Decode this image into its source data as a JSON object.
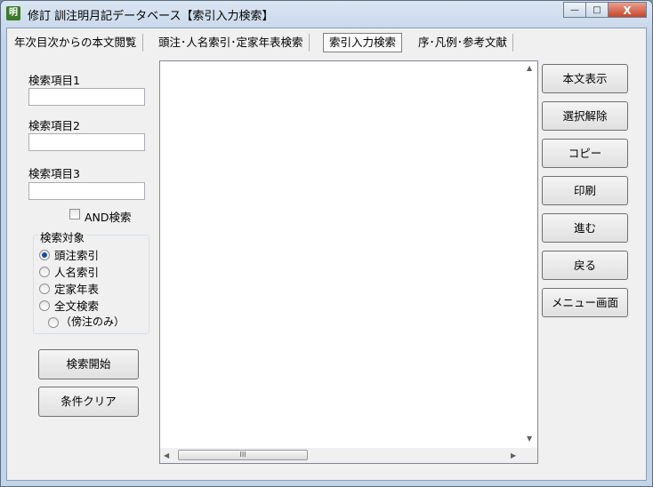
{
  "window": {
    "title": "修訂 訓注明月記データベース【索引入力検索】",
    "icon_text": "明",
    "controls": {
      "minimize": "—",
      "maximize": "□",
      "close": "X"
    }
  },
  "tabs": [
    {
      "label": "年次目次からの本文閲覧"
    },
    {
      "label": "頭注･人名索引･定家年表検索"
    },
    {
      "label": "索引入力検索"
    },
    {
      "label": "序･凡例･参考文献"
    }
  ],
  "search_fields": [
    {
      "label": "検索項目1",
      "value": ""
    },
    {
      "label": "検索項目2",
      "value": ""
    },
    {
      "label": "検索項目3",
      "value": ""
    }
  ],
  "and_checkbox": {
    "label": "AND検索",
    "checked": false
  },
  "target_group": {
    "title": "検索対象",
    "options": [
      {
        "label": "頭注索引",
        "selected": true
      },
      {
        "label": "人名索引",
        "selected": false
      },
      {
        "label": "定家年表",
        "selected": false
      },
      {
        "label": "全文検索",
        "selected": false
      },
      {
        "label": "（傍注のみ）",
        "selected": false
      }
    ]
  },
  "actions": {
    "search_start": "検索開始",
    "clear": "条件クリア"
  },
  "side_buttons": [
    "本文表示",
    "選択解除",
    "コピー",
    "印刷",
    "進む",
    "戻る",
    "メニュー画面"
  ],
  "scrollbar": {
    "thumb_grip": "III",
    "up": "▲",
    "down": "▼",
    "left": "◀",
    "right": "▶"
  }
}
